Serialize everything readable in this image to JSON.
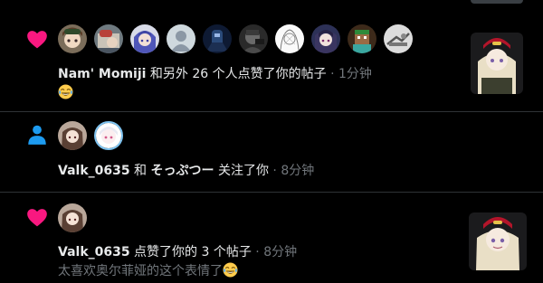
{
  "notifications": [
    {
      "type": "like",
      "actor": "Nam' Momiji",
      "text": " 和另外 26 个人点赞了你的帖子",
      "time": "1分钟",
      "emoji": "laughing-emoji"
    },
    {
      "type": "follow",
      "actor": "Valk_0635",
      "mid": " 和 ",
      "actor2": "そっぷつー",
      "text": " 关注了你",
      "time": "8分钟"
    },
    {
      "type": "like",
      "actor": "Valk_0635",
      "text": " 点赞了你的 3 个帖子",
      "time": "8分钟",
      "subtext": "太喜欢奥尔菲娅的这个表情了"
    }
  ],
  "separator": " · ",
  "colors": {
    "like": "#f91880",
    "follow": "#1d9bf0",
    "background": "#000000",
    "muted": "#71767b"
  }
}
